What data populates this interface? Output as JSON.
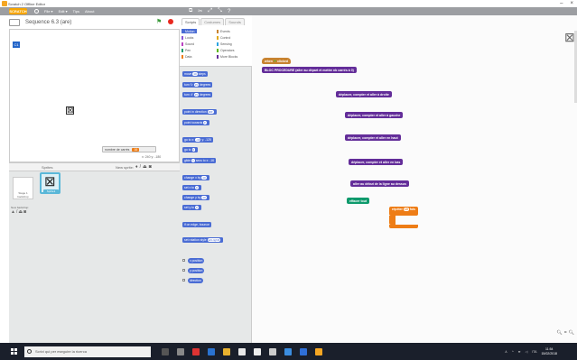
{
  "window": {
    "title": "Scratch 2 Offline Editor",
    "min": "–",
    "close": "×"
  },
  "menubar": {
    "logo": "SCRATCH",
    "items": [
      "File ▾",
      "Edit ▾",
      "Tips",
      "About"
    ]
  },
  "stage": {
    "title": "Sequence 6.3 (are)",
    "coords": "x: 240  y: -180",
    "var_label": "nombre de carrés",
    "var_value": "16"
  },
  "sprites": {
    "header": "Sprites",
    "new_sprite": "New sprite:",
    "stage_label": "Stage 1 backdrop",
    "new_backdrop": "New backdrop:",
    "sprite_name": "Sprite1"
  },
  "tabs": [
    "Scripts",
    "Costumes",
    "Sounds"
  ],
  "categories": [
    {
      "label": "Motion",
      "color": "#4a6cd4",
      "col": 0,
      "row": 0,
      "selected": true
    },
    {
      "label": "Looks",
      "color": "#8a55d7",
      "col": 0,
      "row": 1
    },
    {
      "label": "Sound",
      "color": "#bb42c3",
      "col": 0,
      "row": 2
    },
    {
      "label": "Pen",
      "color": "#0e9a6c",
      "col": 0,
      "row": 3
    },
    {
      "label": "Data",
      "color": "#ee7d16",
      "col": 0,
      "row": 4
    },
    {
      "label": "Events",
      "color": "#c88330",
      "col": 1,
      "row": 0
    },
    {
      "label": "Control",
      "color": "#e1a91a",
      "col": 1,
      "row": 1
    },
    {
      "label": "Sensing",
      "color": "#2ca5e2",
      "col": 1,
      "row": 2
    },
    {
      "label": "Operators",
      "color": "#5cb712",
      "col": 1,
      "row": 3
    },
    {
      "label": "More Blocks",
      "color": "#632d99",
      "col": 1,
      "row": 4
    }
  ],
  "palette_blocks": [
    {
      "pre": "move",
      "slot": "10",
      "post": "steps"
    },
    {
      "pre": "turn ↻",
      "slot": "15",
      "post": "degrees"
    },
    {
      "pre": "turn ↺",
      "slot": "15",
      "post": "degrees"
    },
    {
      "pre": "point in direction",
      "slot": "90▾",
      "post": ""
    },
    {
      "pre": "point towards",
      "slot": "▾",
      "post": ""
    },
    {
      "pre": "go to x:",
      "slot": "-16",
      "post": "y: -125"
    },
    {
      "pre": "go to",
      "slot": "▾",
      "post": ""
    },
    {
      "pre": "glide",
      "slot": "1",
      "post": "secs to x: -16"
    },
    {
      "pre": "change x by",
      "slot": "10",
      "post": ""
    },
    {
      "pre": "set x to",
      "slot": "0",
      "post": ""
    },
    {
      "pre": "change y by",
      "slot": "10",
      "post": ""
    },
    {
      "pre": "set y to",
      "slot": "0",
      "post": ""
    },
    {
      "pre": "if on edge, bounce",
      "slot": "",
      "post": ""
    },
    {
      "pre": "set rotation style",
      "slot": "left-right▾",
      "post": ""
    }
  ],
  "reporters": [
    "x position",
    "y position",
    "direction"
  ],
  "scripts": {
    "hat": "when",
    "hat_post": "clicked",
    "define": "BLOC PROCEDURE (aller au départ et mettre nb carrés à 0)",
    "c1": "déplacer, compter et aller à droite",
    "c2": "déplacer, compter et aller à gauche",
    "c3": "déplacer, compter et aller en haut",
    "c4": "déplacer, compter et aller en bas",
    "c5": "aller au début de la ligne au dessus",
    "pen": "effacer tout",
    "data_pre": "répéter",
    "data_slot": "10",
    "data_post": "fois"
  },
  "taskbar": {
    "search": "Scrivi qui per eseguire la ricerca",
    "time": "11:54",
    "date": "15/02/2018",
    "lang": "ITA"
  }
}
